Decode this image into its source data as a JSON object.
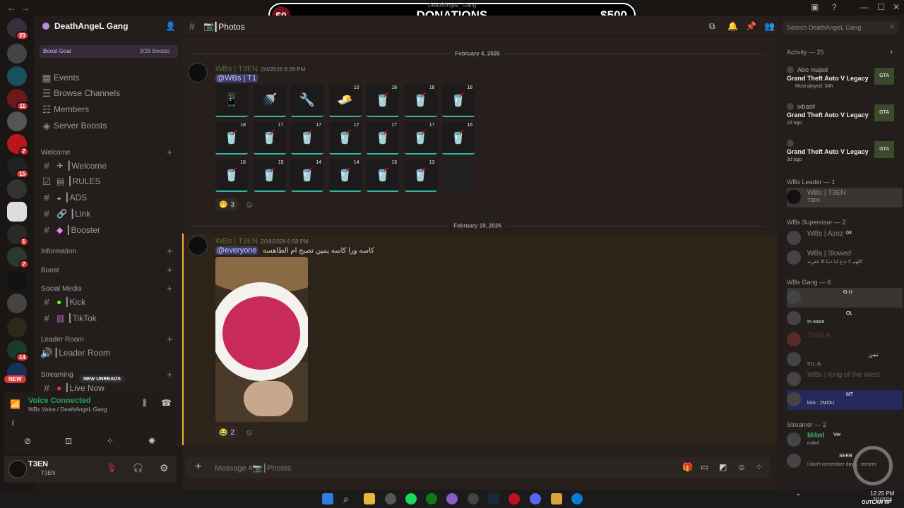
{
  "titlebar": {
    "title": "DeathAngeL_Gang"
  },
  "donation": {
    "left": "$0",
    "center": "DONATIONS",
    "right": "$500"
  },
  "server_badges": [
    "23",
    "11",
    "7",
    "15",
    "1",
    "7",
    "14"
  ],
  "new_label": "NEW",
  "sidebar": {
    "guild_name": "DeathAngeL Gang",
    "boost_goal": "Boost Goal",
    "boost_count": "3/28 Boosts",
    "links": [
      "Events",
      "Browse Channels",
      "Members",
      "Server Boosts"
    ],
    "categories": {
      "welcome": "Welcome",
      "information": "Information",
      "boost": "Boost",
      "social": "Social Media",
      "leader": "Leader Room",
      "streaming": "Streaming"
    },
    "welcome_channels": [
      "┃Welcome",
      "┃RULES",
      "┃ADS",
      "┃Link",
      "┃Booster"
    ],
    "social_channels": [
      "┃Kick",
      "┃TikTok"
    ],
    "leader_channels": [
      "┃Leader Room"
    ],
    "streaming_channels": [
      "┃Live Now"
    ],
    "new_unreads": "NEW UNREADS"
  },
  "voice": {
    "status": "Voice Connected",
    "location": "WBs Voice / DeathAngeL Gang"
  },
  "user": {
    "name": "T3EN",
    "status": "T3EN"
  },
  "channel": {
    "name": "┃Photos",
    "placeholder": "Message #📷┃Photos"
  },
  "messages": {
    "date1": "February 4, 2026",
    "author1": "WBs | T3EN",
    "time1": "2/4/2026 8:28 PM",
    "mention1": "@WBs | T1",
    "reaction1": "3",
    "date2": "February 19, 2026",
    "author2": "WBs | T3EN",
    "time2": "2/19/2026 6:58 PM",
    "mention2": "@everyone",
    "text2": "كاسه ورا كاسه يمين تصبح ام الطاهسه",
    "reaction2": "2"
  },
  "inventory_counts": [
    [
      "",
      "",
      "",
      "10",
      "18",
      "18",
      "18"
    ],
    [
      "18",
      "17",
      "17",
      "17",
      "17",
      "17",
      "16"
    ],
    [
      "16",
      "15",
      "14",
      "14",
      "13",
      "13",
      ""
    ]
  ],
  "search": {
    "placeholder": "Search DeathAngeL Gang"
  },
  "members": {
    "activity_header": "Activity — 25",
    "activities": [
      {
        "user": "Abo majed",
        "game": "Grand Theft Auto V Legacy",
        "sub": "Most played: 34h"
      },
      {
        "user": "ixbasil",
        "game": "Grand Theft Auto V Legacy",
        "sub": "1d ago"
      },
      {
        "user": "",
        "game": "Grand Theft Auto V Legacy",
        "sub": "3d ago"
      }
    ],
    "leader_header": "WBs Leader — 1",
    "leader": {
      "name": "WBs | T3EN",
      "sub": "T3EN"
    },
    "supervisor_header": "WBs Supervisor — 2",
    "supervisors": [
      {
        "name": "WBs | Azoz",
        "tag": "03"
      },
      {
        "name": "WBs | Slowed",
        "sub": "اللهم لا تدع لنا ذنبا الا غفرته"
      }
    ],
    "gang_header": "WBs Gang — 6",
    "gang": [
      {
        "name": "",
        "tag": "G-U"
      },
      {
        "name": "",
        "tag": "OL",
        "sub": "In voice"
      },
      {
        "name": "Tripili A"
      },
      {
        "name": "",
        "tag": "تشن",
        "sub": "911 木"
      },
      {
        "name": "WBs | King of the West"
      },
      {
        "name": "",
        "tag": "MT",
        "sub": "kick : 2MOU"
      }
    ],
    "streamer_header": "Streamer — 2",
    "streamers": [
      {
        "name": "M4wl",
        "tag": "Ver",
        "sub": "m4wl"
      },
      {
        "name": "",
        "tag": "SEEB",
        "sub": "I don't remember day ... remem"
      }
    ]
  },
  "taskbar": {
    "time": "12:25 PM",
    "date": "3/1/2026",
    "watermark": "OUTLAW RP"
  }
}
